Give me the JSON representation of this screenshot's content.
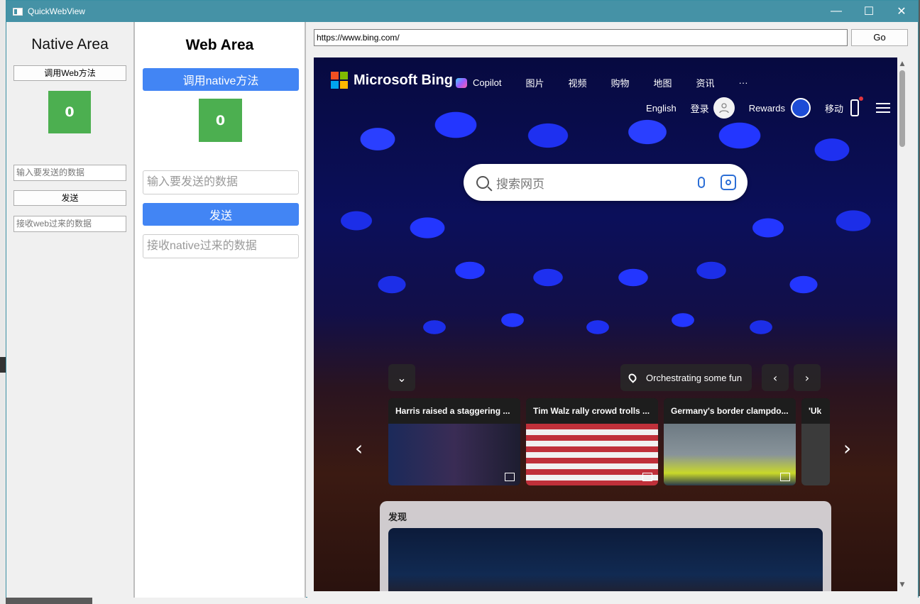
{
  "window": {
    "title": "QuickWebView",
    "controls": {
      "minimize": "—",
      "maximize": "☐",
      "close": "✕"
    }
  },
  "native": {
    "title": "Native Area",
    "call_button": "调用Web方法",
    "counter": "0",
    "input_placeholder": "输入要发送的数据",
    "send_button": "发送",
    "receive_placeholder": "接收web过来的数据"
  },
  "web": {
    "title": "Web Area",
    "call_button": "调用native方法",
    "counter": "0",
    "input_placeholder": "输入要发送的数据",
    "send_button": "发送",
    "receive_placeholder": "接收native过来的数据"
  },
  "browser": {
    "url": "https://www.bing.com/",
    "go_button": "Go"
  },
  "bing": {
    "logo_text": "Microsoft Bing",
    "nav": [
      "Copilot",
      "图片",
      "视频",
      "购物",
      "地图",
      "资讯",
      "···"
    ],
    "util": {
      "language": "English",
      "login": "登录",
      "rewards": "Rewards",
      "mobile": "移动"
    },
    "search_placeholder": "搜索网页",
    "location": "Orchestrating some fun",
    "news": [
      "Harris raised a staggering ...",
      "Tim Walz rally crowd trolls ...",
      "Germany's border clampdo...",
      "'Uk"
    ],
    "discover_label": "发现"
  },
  "colors": {
    "titlebar": "#4592a6",
    "counter": "#4caf50",
    "web_button": "#4285f4"
  }
}
